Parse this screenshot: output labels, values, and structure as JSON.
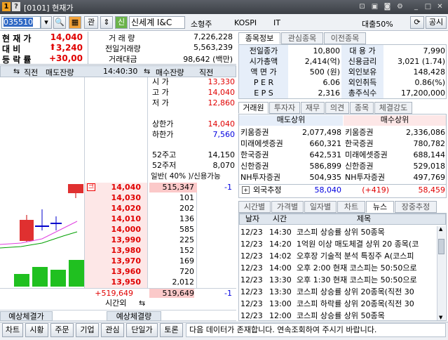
{
  "window": {
    "num1": "1",
    "num2": "?",
    "title": "[0101] 현재가"
  },
  "toolbar": {
    "code": "035510",
    "gwan": "관",
    "sin": "신",
    "stock_name": "신세계 I&C",
    "size": "소형주",
    "market": "KOSPI",
    "sector": "IT",
    "loan": "대출50%",
    "public": "공시"
  },
  "summary": {
    "cur_label": "현 재 가",
    "cur_value": "14,040",
    "diff_label": "대  비",
    "diff_value": "3,240",
    "rate_label": "등 락 률",
    "rate_value": "+30,00",
    "vol_label": "거 래 량",
    "vol_value": "7,226,228",
    "pvol_label": "전일거래량",
    "pvol_value": "5,563,239",
    "amt_label": "거래대금",
    "amt_value": "98,642 (백만)"
  },
  "orderbook": {
    "h_direct": "직전",
    "h_sell_rem": "매도잔량",
    "time": "14:40:30",
    "h_buy_rem": "매수잔량",
    "h_direct2": "직전",
    "info": [
      {
        "k": "시  가",
        "v": "13,330",
        "c": "red"
      },
      {
        "k": "고  가",
        "v": "14,040",
        "c": "red"
      },
      {
        "k": "저  가",
        "v": "12,860",
        "c": "red"
      },
      {
        "k": "상한가",
        "v": "14,040",
        "c": "red"
      },
      {
        "k": "하한가",
        "v": "7,560",
        "c": "blue"
      },
      {
        "k": "52주고",
        "v": "14,150",
        "c": ""
      },
      {
        "k": "52주저",
        "v": "8,070",
        "c": ""
      }
    ],
    "credit": "일반( 40% )/신용가능",
    "rows": [
      {
        "price": "14,040",
        "qty": "515,347",
        "chg": "-1",
        "mark": "크"
      },
      {
        "price": "14,030",
        "qty": "101"
      },
      {
        "price": "14,020",
        "qty": "202"
      },
      {
        "price": "14,010",
        "qty": "136"
      },
      {
        "price": "14,000",
        "qty": "585"
      },
      {
        "price": "13,990",
        "qty": "225"
      },
      {
        "price": "13,980",
        "qty": "152"
      },
      {
        "price": "13,970",
        "qty": "169"
      },
      {
        "price": "13,960",
        "qty": "720"
      },
      {
        "price": "13,950",
        "qty": "2,012"
      }
    ],
    "foot_left": "+519,649",
    "foot_total": "519,649",
    "foot_chg": "-1",
    "after": "시간외",
    "exp_label1": "예상체결가",
    "exp_label2": "예상체결량"
  },
  "right_tabs": [
    "종목정보",
    "관심종목",
    "이전종목"
  ],
  "info": [
    {
      "k1": "전일종가",
      "v1": "10,800",
      "k2": "대 용 가",
      "v2": "7,990"
    },
    {
      "k1": "시가총액",
      "v1": "2,414(억)",
      "k2": "신용금리",
      "v2": "3,021  (1.74)"
    },
    {
      "k1": "액 면 가",
      "v1": "500 (원)",
      "k2": "외인보유",
      "v2": "148,428"
    },
    {
      "k1": "P E R",
      "v1": "6.06",
      "k2": "외인취득",
      "v2": "0.86(%)"
    },
    {
      "k1": "E P S",
      "v1": "2,316",
      "k2": "총주식수",
      "v2": "17,200,000"
    }
  ],
  "broker_tabs": [
    "거래원",
    "투자자",
    "재무",
    "의견",
    "종목",
    "체결강도"
  ],
  "broker": {
    "sell_h": "매도상위",
    "buy_h": "매수상위",
    "rows": [
      {
        "s": "키움증권",
        "sv": "2,077,498",
        "b": "키움증권",
        "bv": "2,336,086"
      },
      {
        "s": "미래에셋증권",
        "sv": "660,321",
        "b": "한국증권",
        "bv": "780,782"
      },
      {
        "s": "한국증권",
        "sv": "642,531",
        "b": "미래에셋증권",
        "bv": "688,144"
      },
      {
        "s": "신한증권",
        "sv": "586,899",
        "b": "신한증권",
        "bv": "529,018"
      },
      {
        "s": "NH투자증권",
        "sv": "504,935",
        "b": "NH투자증권",
        "bv": "497,769"
      }
    ],
    "foreign_label": "외국추정",
    "foreign_sell": "58,040",
    "foreign_diff": "(+419)",
    "foreign_buy": "58,459"
  },
  "news_tabs": [
    "시간별",
    "가격별",
    "일자별",
    "차트",
    "뉴스",
    "장중추정"
  ],
  "news": {
    "h_date": "날자",
    "h_time": "시간",
    "h_title": "제목",
    "rows": [
      {
        "d": "12/23",
        "t": "14:30",
        "title": "코스피 상승률 상위 50종목"
      },
      {
        "d": "12/23",
        "t": "14:20",
        "title": "1억원 이상 매도체결 상위 20 종목(코"
      },
      {
        "d": "12/23",
        "t": "14:02",
        "title": "오후장 기술적 분석 특징주 A(코스피"
      },
      {
        "d": "12/23",
        "t": "14:00",
        "title": "오후 2:00 현재 코스피는 50:50으로"
      },
      {
        "d": "12/23",
        "t": "13:30",
        "title": "오후 1:30 현재 코스피는 50:50으로"
      },
      {
        "d": "12/23",
        "t": "13:30",
        "title": "코스피 상승률 상위 20종목(직전 30"
      },
      {
        "d": "12/23",
        "t": "13:00",
        "title": "코스피 하락률 상위 20종목(직전 30"
      },
      {
        "d": "12/23",
        "t": "12:00",
        "title": "코스피 상승률 상위 50종목"
      }
    ]
  },
  "bottom": {
    "buttons": [
      "차트",
      "시황",
      "주문",
      "기업",
      "관심",
      "단일가",
      "토론"
    ],
    "status": "다음 데이터가 존재합니다. 연속조회하여 주시기 바랍니다."
  },
  "colors": {
    "up": "#e00000",
    "down": "#0000e0"
  }
}
